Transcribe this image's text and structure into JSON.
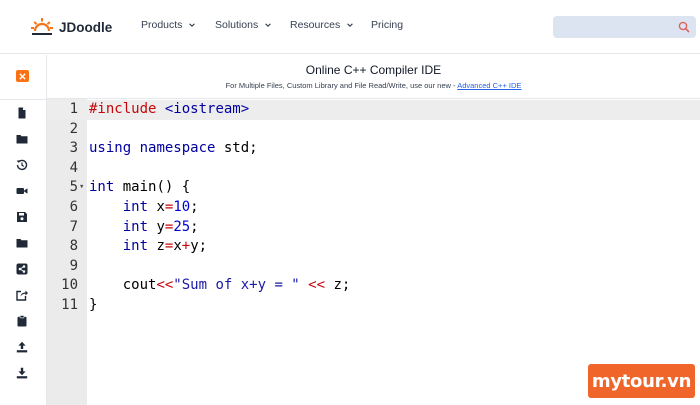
{
  "brand": {
    "name": "JDoodle",
    "logo_color": "#f97316"
  },
  "nav": {
    "items": [
      {
        "label": "Products",
        "dropdown": true
      },
      {
        "label": "Solutions",
        "dropdown": true
      },
      {
        "label": "Resources",
        "dropdown": true
      },
      {
        "label": "Pricing",
        "dropdown": false
      }
    ],
    "search_placeholder": "",
    "search_icon": "search-icon"
  },
  "sidebar": {
    "close_icon": "close-icon",
    "icons": [
      "new-file-icon",
      "folder-icon",
      "history-icon",
      "video-icon",
      "save-icon",
      "open-folder-icon",
      "share-icon",
      "export-icon",
      "clipboard-icon",
      "upload-icon",
      "download-icon"
    ]
  },
  "header": {
    "title": "Online C++ Compiler IDE",
    "subtitle_prefix": "For Multiple Files, Custom Library and File Read/Write, use our new - ",
    "subtitle_link": "Advanced C++ IDE"
  },
  "editor": {
    "active_line": 1,
    "lines": [
      {
        "n": "1",
        "tokens": [
          [
            "kw-pre",
            "#include"
          ],
          [
            "plain",
            " "
          ],
          [
            "kw-blue",
            "<iostream>"
          ]
        ]
      },
      {
        "n": "2",
        "tokens": []
      },
      {
        "n": "3",
        "tokens": [
          [
            "kw-type",
            "using"
          ],
          [
            "plain",
            " "
          ],
          [
            "kw-type",
            "namespace"
          ],
          [
            "plain",
            " std;"
          ]
        ]
      },
      {
        "n": "4",
        "tokens": []
      },
      {
        "n": "5",
        "fold": true,
        "tokens": [
          [
            "kw-type",
            "int"
          ],
          [
            "plain",
            " main() {"
          ]
        ]
      },
      {
        "n": "6",
        "tokens": [
          [
            "plain",
            "    "
          ],
          [
            "kw-type",
            "int"
          ],
          [
            "plain",
            " x"
          ],
          [
            "op",
            "="
          ],
          [
            "num",
            "10"
          ],
          [
            "plain",
            ";"
          ]
        ]
      },
      {
        "n": "7",
        "tokens": [
          [
            "plain",
            "    "
          ],
          [
            "kw-type",
            "int"
          ],
          [
            "plain",
            " y"
          ],
          [
            "op",
            "="
          ],
          [
            "num",
            "25"
          ],
          [
            "plain",
            ";"
          ]
        ]
      },
      {
        "n": "8",
        "tokens": [
          [
            "plain",
            "    "
          ],
          [
            "kw-type",
            "int"
          ],
          [
            "plain",
            " z"
          ],
          [
            "op",
            "="
          ],
          [
            "plain",
            "x"
          ],
          [
            "op",
            "+"
          ],
          [
            "plain",
            "y;"
          ]
        ]
      },
      {
        "n": "9",
        "tokens": []
      },
      {
        "n": "10",
        "tokens": [
          [
            "plain",
            "    cout"
          ],
          [
            "op",
            "<<"
          ],
          [
            "str",
            "\"Sum of x+y = \""
          ],
          [
            "plain",
            " "
          ],
          [
            "op",
            "<<"
          ],
          [
            "plain",
            " z;"
          ]
        ]
      },
      {
        "n": "11",
        "tokens": [
          [
            "plain",
            "}"
          ]
        ]
      }
    ]
  },
  "watermark": {
    "text": "mytour.vn",
    "color": "#f0652a"
  }
}
